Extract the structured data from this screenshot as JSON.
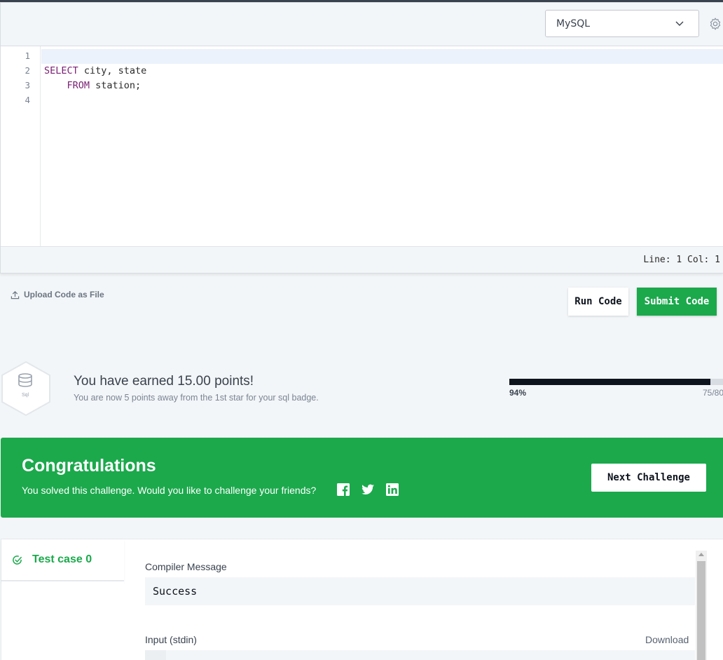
{
  "editor": {
    "language": "MySQL",
    "line_numbers": [
      "1",
      "2",
      "3",
      "4"
    ],
    "lines": [
      {
        "keyword": "",
        "rest": ""
      },
      {
        "keyword": "SELECT",
        "rest": " city, state"
      },
      {
        "keyword": "    FROM",
        "rest": " station;"
      },
      {
        "keyword": "",
        "rest": ""
      }
    ],
    "status": "Line: 1 Col: 1"
  },
  "actions": {
    "upload_label": "Upload Code as File",
    "run_label": "Run Code",
    "submit_label": "Submit Code"
  },
  "points": {
    "badge_label": "Sql",
    "title": "You have earned 15.00 points!",
    "subtitle": "You are now 5 points away from the 1st star for your sql badge.",
    "progress_percent_label": "94%",
    "progress_fraction": 0.94,
    "progress_count": "75/80"
  },
  "congrats": {
    "title": "Congratulations",
    "subtitle": "You solved this challenge. Would you like to challenge your friends?",
    "next_label": "Next Challenge"
  },
  "results": {
    "tab_label": "Test case 0",
    "compiler_label": "Compiler Message",
    "compiler_message": "Success",
    "input_label": "Input (stdin)",
    "download_label": "Download"
  },
  "colors": {
    "accent_green": "#1ba94c",
    "dark": "#0e141e"
  }
}
